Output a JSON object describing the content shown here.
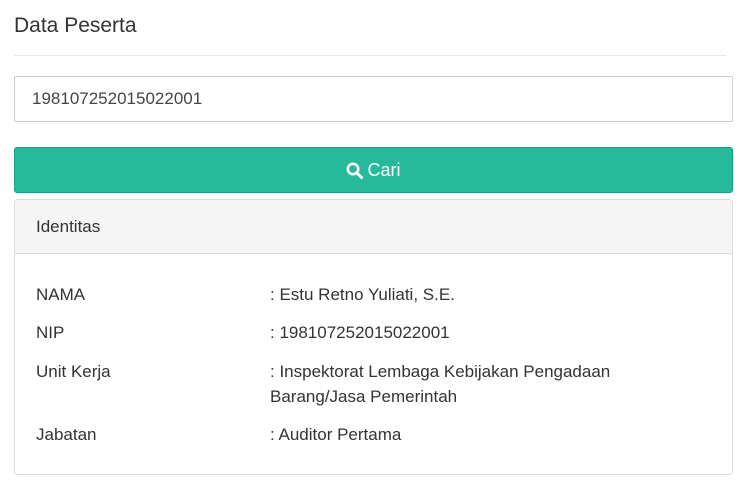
{
  "page": {
    "title": "Data Peserta"
  },
  "search": {
    "value": "198107252015022001",
    "button_label": "Cari"
  },
  "panel": {
    "heading": "Identitas",
    "rows": [
      {
        "label": "NAMA",
        "value": ": Estu Retno Yuliati, S.E."
      },
      {
        "label": "NIP",
        "value": ": 198107252015022001"
      },
      {
        "label": "Unit Kerja",
        "value": ": Inspektorat Lembaga Kebijakan Pengadaan Barang/Jasa Pemerintah"
      },
      {
        "label": "Jabatan",
        "value": ": Auditor Pertama"
      }
    ]
  },
  "colors": {
    "button_bg": "#26b99a",
    "button_border": "#169f85",
    "panel_heading_bg": "#f5f5f5"
  },
  "icons": {
    "search_button_icon": "search-icon"
  }
}
